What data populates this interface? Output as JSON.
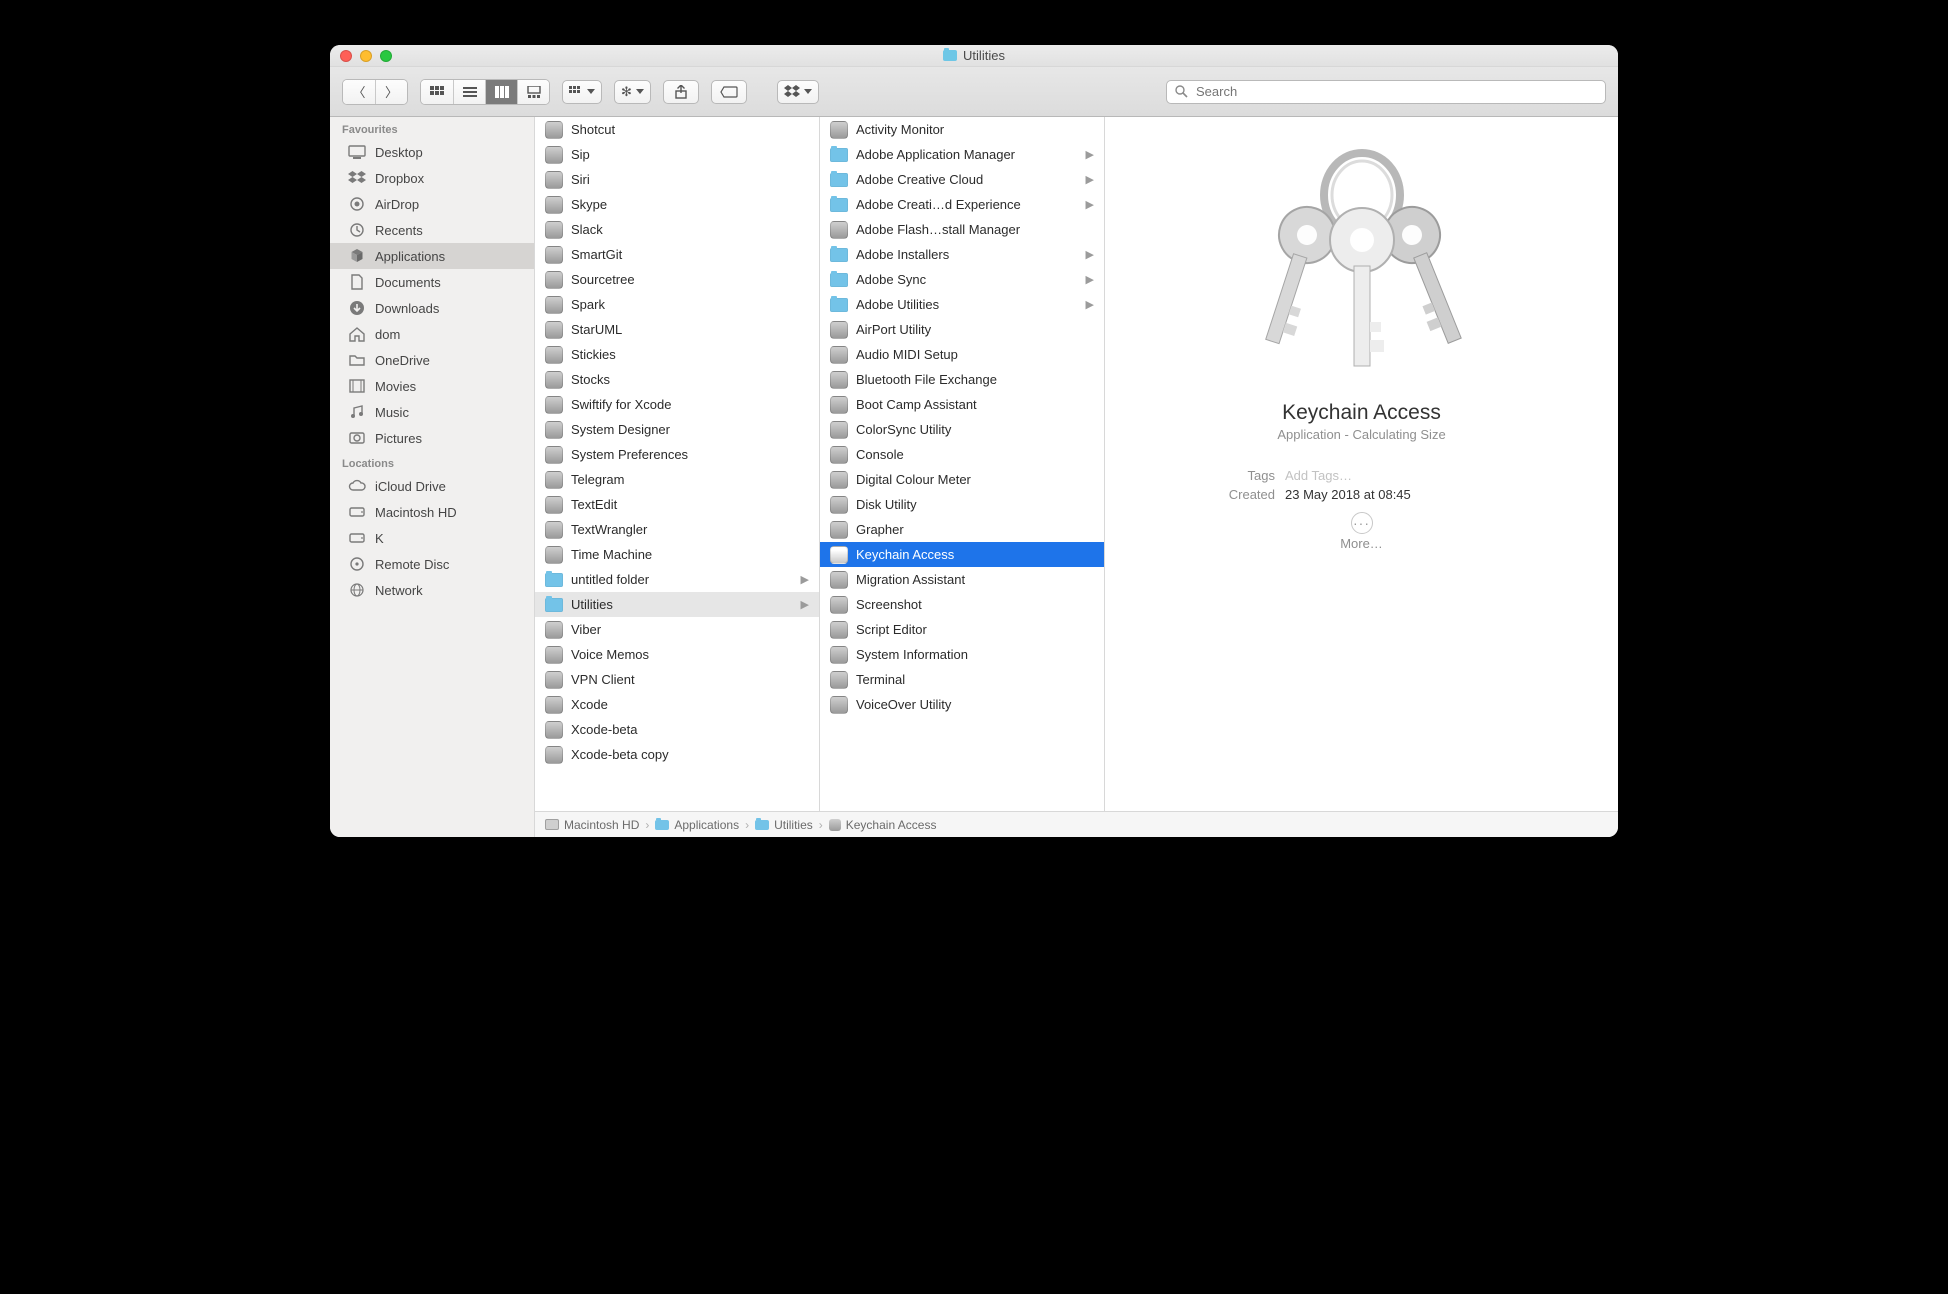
{
  "window": {
    "title": "Utilities"
  },
  "toolbar": {
    "search_placeholder": "Search",
    "dropbox_label": "Dropbox"
  },
  "sidebar": {
    "sections": [
      {
        "label": "Favourites",
        "items": [
          {
            "icon": "desktop",
            "label": "Desktop"
          },
          {
            "icon": "dropbox",
            "label": "Dropbox"
          },
          {
            "icon": "airdrop",
            "label": "AirDrop"
          },
          {
            "icon": "recents",
            "label": "Recents"
          },
          {
            "icon": "apps",
            "label": "Applications",
            "selected": true
          },
          {
            "icon": "docs",
            "label": "Documents"
          },
          {
            "icon": "downloads",
            "label": "Downloads"
          },
          {
            "icon": "home",
            "label": "dom"
          },
          {
            "icon": "folder",
            "label": "OneDrive"
          },
          {
            "icon": "movies",
            "label": "Movies"
          },
          {
            "icon": "music",
            "label": "Music"
          },
          {
            "icon": "pictures",
            "label": "Pictures"
          }
        ]
      },
      {
        "label": "Locations",
        "items": [
          {
            "icon": "icloud",
            "label": "iCloud Drive"
          },
          {
            "icon": "hd",
            "label": "Macintosh HD"
          },
          {
            "icon": "hd",
            "label": "K"
          },
          {
            "icon": "disc",
            "label": "Remote Disc"
          },
          {
            "icon": "globe",
            "label": "Network"
          }
        ]
      }
    ]
  },
  "columns": {
    "apps": [
      {
        "label": "Shotcut",
        "kind": "app"
      },
      {
        "label": "Sip",
        "kind": "app"
      },
      {
        "label": "Siri",
        "kind": "app"
      },
      {
        "label": "Skype",
        "kind": "app"
      },
      {
        "label": "Slack",
        "kind": "app"
      },
      {
        "label": "SmartGit",
        "kind": "app"
      },
      {
        "label": "Sourcetree",
        "kind": "app"
      },
      {
        "label": "Spark",
        "kind": "app"
      },
      {
        "label": "StarUML",
        "kind": "app"
      },
      {
        "label": "Stickies",
        "kind": "app"
      },
      {
        "label": "Stocks",
        "kind": "app"
      },
      {
        "label": "Swiftify for Xcode",
        "kind": "app"
      },
      {
        "label": "System Designer",
        "kind": "app"
      },
      {
        "label": "System Preferences",
        "kind": "app"
      },
      {
        "label": "Telegram",
        "kind": "app"
      },
      {
        "label": "TextEdit",
        "kind": "app"
      },
      {
        "label": "TextWrangler",
        "kind": "app"
      },
      {
        "label": "Time Machine",
        "kind": "app"
      },
      {
        "label": "untitled folder",
        "kind": "folder",
        "hasChildren": true
      },
      {
        "label": "Utilities",
        "kind": "folder",
        "hasChildren": true,
        "selected": true
      },
      {
        "label": "Viber",
        "kind": "app"
      },
      {
        "label": "Voice Memos",
        "kind": "app"
      },
      {
        "label": "VPN Client",
        "kind": "app"
      },
      {
        "label": "Xcode",
        "kind": "app"
      },
      {
        "label": "Xcode-beta",
        "kind": "app"
      },
      {
        "label": "Xcode-beta copy",
        "kind": "app"
      }
    ],
    "utilities": [
      {
        "label": "Activity Monitor",
        "kind": "app"
      },
      {
        "label": "Adobe Application Manager",
        "kind": "folder",
        "hasChildren": true
      },
      {
        "label": "Adobe Creative Cloud",
        "kind": "folder",
        "hasChildren": true
      },
      {
        "label": "Adobe Creati…d Experience",
        "kind": "folder",
        "hasChildren": true
      },
      {
        "label": "Adobe Flash…stall Manager",
        "kind": "app"
      },
      {
        "label": "Adobe Installers",
        "kind": "folder",
        "hasChildren": true
      },
      {
        "label": "Adobe Sync",
        "kind": "folder",
        "hasChildren": true
      },
      {
        "label": "Adobe Utilities",
        "kind": "folder",
        "hasChildren": true
      },
      {
        "label": "AirPort Utility",
        "kind": "app"
      },
      {
        "label": "Audio MIDI Setup",
        "kind": "app"
      },
      {
        "label": "Bluetooth File Exchange",
        "kind": "app"
      },
      {
        "label": "Boot Camp Assistant",
        "kind": "app"
      },
      {
        "label": "ColorSync Utility",
        "kind": "app"
      },
      {
        "label": "Console",
        "kind": "app"
      },
      {
        "label": "Digital Colour Meter",
        "kind": "app"
      },
      {
        "label": "Disk Utility",
        "kind": "app"
      },
      {
        "label": "Grapher",
        "kind": "app"
      },
      {
        "label": "Keychain Access",
        "kind": "app",
        "hilite": true
      },
      {
        "label": "Migration Assistant",
        "kind": "app"
      },
      {
        "label": "Screenshot",
        "kind": "app"
      },
      {
        "label": "Script Editor",
        "kind": "app"
      },
      {
        "label": "System Information",
        "kind": "app"
      },
      {
        "label": "Terminal",
        "kind": "app"
      },
      {
        "label": "VoiceOver Utility",
        "kind": "app"
      }
    ]
  },
  "preview": {
    "title": "Keychain Access",
    "subtitle": "Application - Calculating Size",
    "tags_label": "Tags",
    "tags_placeholder": "Add Tags…",
    "created_label": "Created",
    "created_value": "23 May 2018 at 08:45",
    "more_label": "More…"
  },
  "pathbar": [
    {
      "icon": "hd",
      "label": "Macintosh HD"
    },
    {
      "icon": "folder",
      "label": "Applications"
    },
    {
      "icon": "folder",
      "label": "Utilities"
    },
    {
      "icon": "app",
      "label": "Keychain Access"
    }
  ]
}
